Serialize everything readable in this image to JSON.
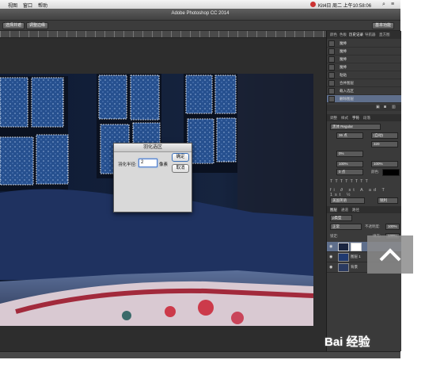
{
  "menubar": {
    "items": [
      "视图",
      "窗口",
      "帮助"
    ],
    "clock": "Kit4日 周二 上午10:58:06"
  },
  "titlebar": {
    "title": "Adobe Photoshop CC 2014"
  },
  "options": {
    "select_subject": "选择并遮",
    "refine": "调整边缘",
    "workspace": "基本功能"
  },
  "dialog": {
    "title": "羽化选区",
    "radius_label": "羽化半径:",
    "radius_value": "2",
    "unit": "像素",
    "ok": "确定",
    "cancel": "取消"
  },
  "panel": {
    "top_tabs": [
      "颜色",
      "色板",
      "历史记录",
      "导航器",
      "直方图"
    ],
    "history": [
      "魔棒",
      "魔棒",
      "魔棒",
      "魔棒",
      "粘贴",
      "合并图层",
      "载入选区",
      "删除图层"
    ],
    "char_tabs": [
      "调整",
      "样式",
      "字符",
      "段落"
    ],
    "font": "黑体 Regular",
    "size": "36 点",
    "leading": "(自动)",
    "tracking": "320",
    "kern": "0%",
    "scale_v": "100%",
    "scale_h": "100%",
    "baseline": "0 点",
    "color_label": "颜色:",
    "lang": "美国英语",
    "aa": "锐利",
    "layer_tabs": [
      "图层",
      "通道",
      "路径"
    ],
    "kind": "ρ类型",
    "blend": "正常",
    "opacity_label": "不透明度:",
    "opacity": "100%",
    "lock_label": "锁定:",
    "fill_label": "填充:",
    "fill": "100%",
    "layers": [
      "",
      "图层 1",
      "背景"
    ]
  },
  "watermark": "Bai 经验",
  "colors": {
    "accent": "#3a6fb8",
    "bg_dark": "#2d2d2d",
    "panel": "#3a3a3a"
  }
}
